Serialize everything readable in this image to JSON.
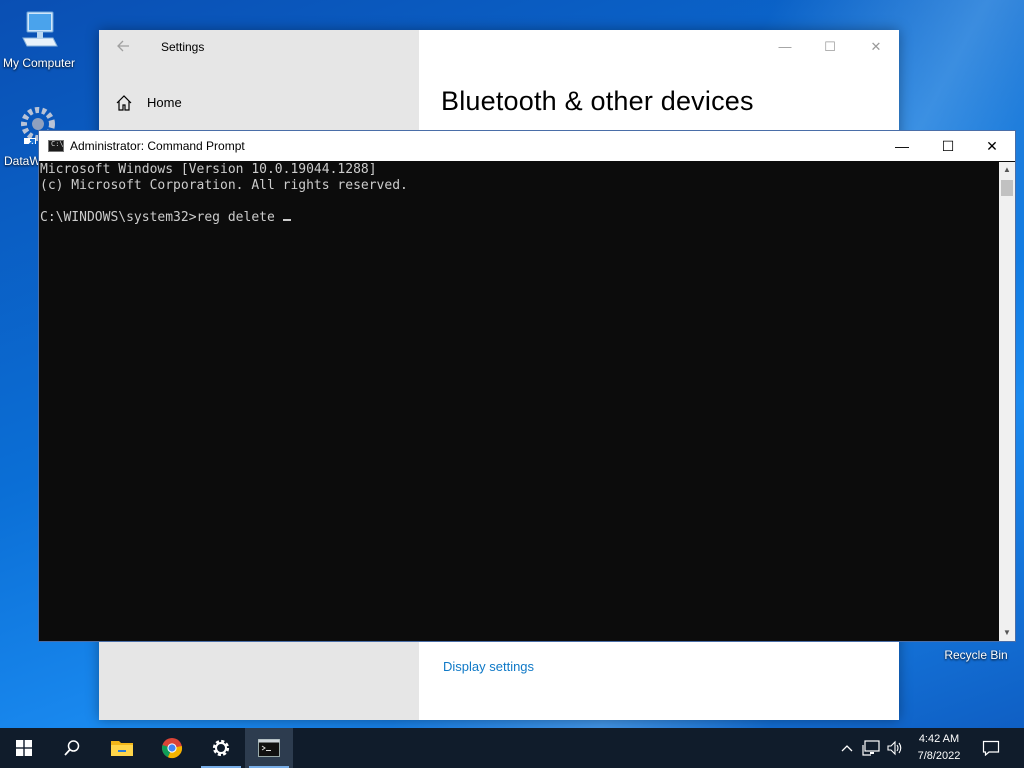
{
  "desktop": {
    "icons": [
      {
        "label": "My Computer"
      },
      {
        "label": "DataW"
      },
      {
        "label": "Recycle Bin"
      }
    ]
  },
  "settings": {
    "title": "Settings",
    "home_label": "Home",
    "heading": "Bluetooth & other devices",
    "display_link": "Display settings",
    "controls": {
      "minimize": "—",
      "maximize": "☐",
      "close": "✕"
    }
  },
  "cmd": {
    "title": "Administrator: Command Prompt",
    "controls": {
      "minimize": "—",
      "maximize": "☐",
      "close": "✕"
    },
    "lines": [
      "Microsoft Windows [Version 10.0.19044.1288]",
      "(c) Microsoft Corporation. All rights reserved.",
      "",
      "C:\\WINDOWS\\system32>reg delete "
    ]
  },
  "taskbar": {
    "items": [
      {
        "icon": "windows-start-icon",
        "running": false
      },
      {
        "icon": "search-icon",
        "running": false
      },
      {
        "icon": "file-explorer-icon",
        "running": false
      },
      {
        "icon": "chrome-icon",
        "running": false
      },
      {
        "icon": "settings-gear-icon",
        "running": true
      },
      {
        "icon": "command-prompt-icon",
        "running": true
      }
    ],
    "time": "4:42 AM",
    "date": "7/8/2022"
  }
}
